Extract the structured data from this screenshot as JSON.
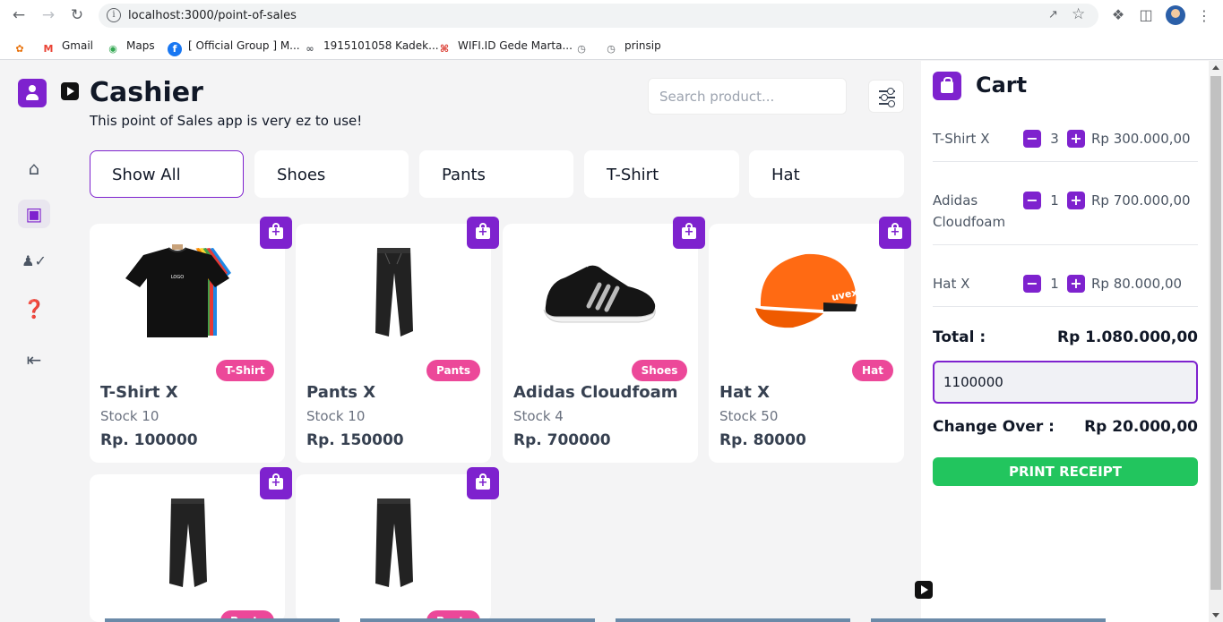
{
  "browser": {
    "url": "localhost:3000/point-of-sales",
    "bookmarks": [
      {
        "label": "",
        "icon": "sunflower-icon",
        "color": "#e8710a"
      },
      {
        "label": "Gmail",
        "icon": "gmail-icon",
        "color": "#ea4335"
      },
      {
        "label": "Maps",
        "icon": "maps-icon",
        "color": "#34a853"
      },
      {
        "label": "[ Official Group ] M...",
        "icon": "facebook-icon",
        "color": "#1877f2"
      },
      {
        "label": "1915101058 Kadek...",
        "icon": "link-icon",
        "color": "#5f6368"
      },
      {
        "label": "WIFI.ID Gede Marta...",
        "icon": "wifi-icon",
        "color": "#d93025"
      },
      {
        "label": "",
        "icon": "globe-icon",
        "color": "#5f6368"
      },
      {
        "label": "prinsip",
        "icon": "globe-icon",
        "color": "#5f6368"
      }
    ]
  },
  "header": {
    "title": "Cashier",
    "subtitle": "This point of Sales app is very ez to use!",
    "search_placeholder": "Search product..."
  },
  "categories": [
    "Show All",
    "Shoes",
    "Pants",
    "T-Shirt",
    "Hat"
  ],
  "active_category": "Show All",
  "products": [
    {
      "name": "T-Shirt X",
      "stock": "Stock 10",
      "price": "Rp. 100000",
      "category": "T-Shirt"
    },
    {
      "name": "Pants X",
      "stock": "Stock 10",
      "price": "Rp. 150000",
      "category": "Pants"
    },
    {
      "name": "Adidas Cloudfoam",
      "stock": "Stock 4",
      "price": "Rp. 700000",
      "category": "Shoes"
    },
    {
      "name": "Hat X",
      "stock": "Stock 50",
      "price": "Rp. 80000",
      "category": "Hat"
    },
    {
      "name": "",
      "stock": "",
      "price": "",
      "category": "Pants"
    },
    {
      "name": "",
      "stock": "",
      "price": "",
      "category": "Pants"
    }
  ],
  "cart": {
    "title": "Cart",
    "items": [
      {
        "name": "T-Shirt X",
        "qty": "3",
        "price": "Rp 300.000,00"
      },
      {
        "name": "Adidas Cloudfoam",
        "qty": "1",
        "price": "Rp 700.000,00"
      },
      {
        "name": "Hat X",
        "qty": "1",
        "price": "Rp 80.000,00"
      }
    ],
    "total_label": "Total :",
    "total_value": "Rp 1.080.000,00",
    "payment_value": "1100000",
    "change_label": "Change Over :",
    "change_value": "Rp 20.000,00",
    "print_label": "PRINT RECEIPT",
    "minus": "−",
    "plus": "+"
  },
  "colors": {
    "accent": "#7e22ce",
    "badge": "#ec4899",
    "success": "#22c55e"
  }
}
